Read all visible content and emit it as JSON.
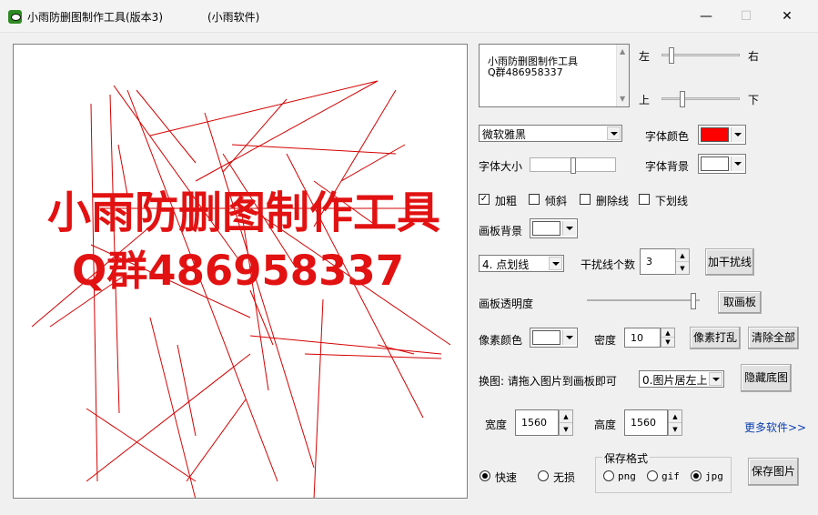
{
  "window": {
    "title": "小雨防删图制作工具(版本3)",
    "subtitle": "(小雨软件)",
    "minimize": "—",
    "maximize": "☐",
    "close": "✕"
  },
  "canvas": {
    "line1": "小雨防删图制作工具",
    "line2": "Q群486958337",
    "line_color": "#d40000",
    "text_color": "#e21212"
  },
  "text_input": {
    "value": "小雨防删图制作工具\n  Q群486958337"
  },
  "position": {
    "left_label": "左",
    "right_label": "右",
    "up_label": "上",
    "down_label": "下"
  },
  "font": {
    "family_value": "微软雅黑",
    "size_label": "字体大小",
    "color_label": "字体颜色",
    "color_value": "#ff0000",
    "bg_label": "字体背景",
    "bg_value": "#ffffff"
  },
  "styles": {
    "bold": "加粗",
    "italic": "倾斜",
    "strike": "删除线",
    "underline": "下划线"
  },
  "board_bg": {
    "label": "画板背景",
    "color": "#ffffff"
  },
  "noise": {
    "line_style": "4. 点划线",
    "count_label": "干扰线个数",
    "count_value": "3",
    "add_button": "加干扰线"
  },
  "opacity": {
    "label": "画板透明度",
    "level": 0.97,
    "button": "取画板"
  },
  "pixel": {
    "color_label": "像素颜色",
    "color": "#ffffff",
    "density_label": "密度",
    "density_value": "10",
    "scramble_button": "像素打乱",
    "clear_button": "清除全部"
  },
  "swap": {
    "label": "换图: 请拖入图片到画板即可",
    "position_value": "0.图片居左上",
    "hide_button": "隐藏底图"
  },
  "size": {
    "width_label": "宽度",
    "width_value": "1560",
    "height_label": "高度",
    "height_value": "1560",
    "more_link": "更多软件>>"
  },
  "save": {
    "fast_label": "快速",
    "lossless_label": "无损",
    "format_group": "保存格式",
    "formats": [
      "png",
      "gif",
      "jpg"
    ],
    "selected_format": "jpg",
    "save_button": "保存图片"
  },
  "icons": {
    "app": "eye-app-icon",
    "checkmark": "✓",
    "spin_up": "▲",
    "spin_down": "▼",
    "scroll_up": "▲",
    "scroll_down": "▼"
  }
}
